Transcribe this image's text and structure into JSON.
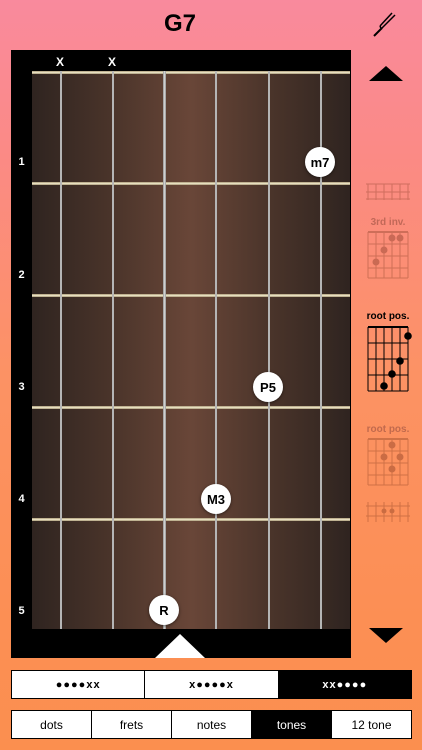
{
  "chord": {
    "name": "G7"
  },
  "toolbar": {
    "tuner_icon": "tuning-fork-icon"
  },
  "fretboard": {
    "mute_markers": [
      "X",
      "X"
    ],
    "fret_numbers": [
      "1",
      "2",
      "3",
      "4",
      "5"
    ],
    "notes": [
      {
        "label": "m7"
      },
      {
        "label": "P5"
      },
      {
        "label": "M3"
      },
      {
        "label": "R"
      }
    ]
  },
  "voicings": {
    "up_icon": "triangle-up-icon",
    "down_icon": "triangle-down-icon",
    "labels": [
      "3rd inv.",
      "root pos.",
      "root pos."
    ]
  },
  "string_selector": {
    "options": [
      "●●●●xx",
      "x●●●●x",
      "xx●●●●"
    ],
    "selected": 2
  },
  "display_mode": {
    "options": [
      "dots",
      "frets",
      "notes",
      "tones",
      "12 tone"
    ],
    "selected": 3
  },
  "colors": {
    "background_top": "#f98a9d",
    "background_bottom": "#fb8f4f",
    "board_center": "#694638",
    "fret_wire": "#f4ecd0"
  }
}
